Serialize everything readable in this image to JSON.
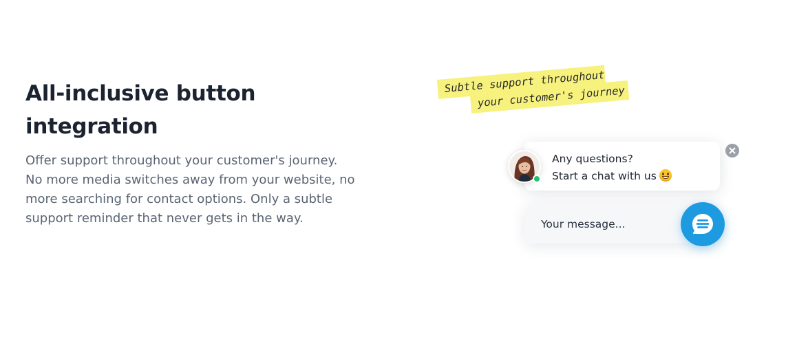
{
  "feature": {
    "title": "All-inclusive button integration",
    "description": "Offer support throughout your customer's journey. No more media switches away from your website, no more searching for contact options. Only a subtle support reminder that never gets in the way."
  },
  "annotation": {
    "line_1": "Subtle support throughout",
    "line_2": "your customer's journey",
    "color": "#f7f27e"
  },
  "chat_widget": {
    "greeting_line_1": "Any questions?",
    "greeting_line_2": "Start a chat with us",
    "greeting_emoji": "grinning-face",
    "agent_status": "online",
    "message_placeholder": "Your message...",
    "accent_color": "#1e9ae0",
    "status_color": "#25c26e"
  }
}
